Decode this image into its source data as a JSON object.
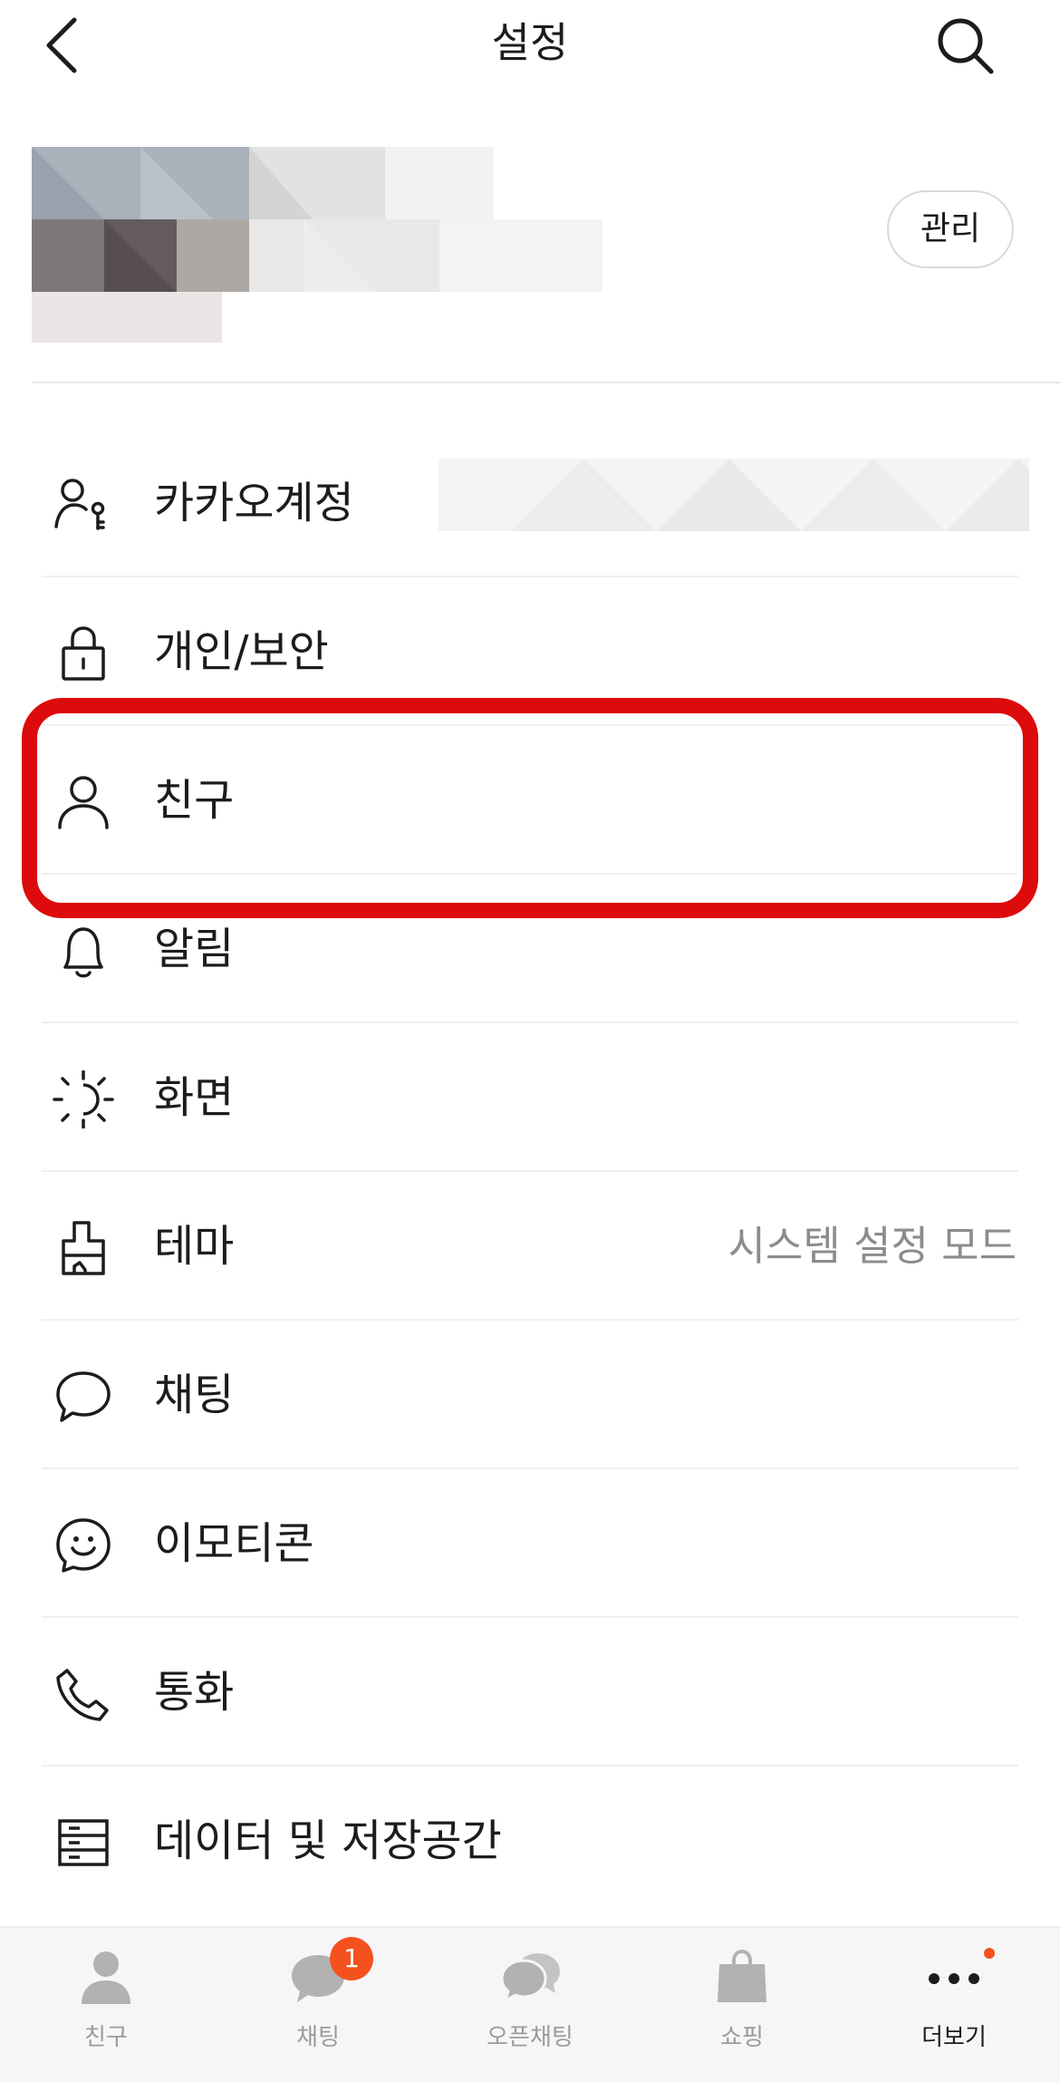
{
  "header": {
    "title": "설정"
  },
  "profile": {
    "manage_label": "관리"
  },
  "settings": {
    "items": [
      {
        "label": "카카오계정",
        "icon": "account-key-icon"
      },
      {
        "label": "개인/보안",
        "icon": "lock-icon"
      },
      {
        "label": "친구",
        "icon": "person-icon"
      },
      {
        "label": "알림",
        "icon": "bell-icon"
      },
      {
        "label": "화면",
        "icon": "brightness-icon"
      },
      {
        "label": "테마",
        "icon": "paint-brush-icon",
        "value": "시스템 설정 모드"
      },
      {
        "label": "채팅",
        "icon": "chat-bubble-icon"
      },
      {
        "label": "이모티콘",
        "icon": "emoticon-icon"
      },
      {
        "label": "통화",
        "icon": "phone-icon"
      },
      {
        "label": "데이터 및 저장공간",
        "icon": "storage-icon"
      }
    ]
  },
  "tabs": [
    {
      "label": "친구",
      "icon": "friends-icon"
    },
    {
      "label": "채팅",
      "icon": "chat-icon",
      "badge": "1"
    },
    {
      "label": "오픈채팅",
      "icon": "open-chat-icon"
    },
    {
      "label": "쇼핑",
      "icon": "shopping-bag-icon"
    },
    {
      "label": "더보기",
      "icon": "more-icon",
      "active": true
    }
  ],
  "colors": {
    "highlight": "#dd0b0b",
    "badge": "#f5511e",
    "text": "#1c1c1c",
    "secondary_text": "#8c8c8c",
    "inactive_tab": "#9b9b9b"
  }
}
